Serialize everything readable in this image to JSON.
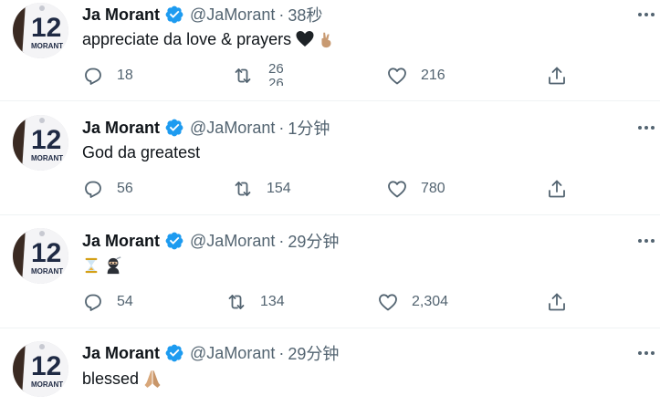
{
  "tweets": [
    {
      "name": "Ja Morant",
      "handle": "@JaMorant",
      "time": "38秒",
      "text": "appreciate da love & prayers",
      "emojis": [
        "black-heart-emoji",
        "crossed-fingers-emoji"
      ],
      "replies": "18",
      "retweets_visible": "26",
      "retweets_next": "26",
      "likes": "216"
    },
    {
      "name": "Ja Morant",
      "handle": "@JaMorant",
      "time": "1分钟",
      "text": "God da greatest",
      "replies": "56",
      "retweets": "154",
      "likes": "780"
    },
    {
      "name": "Ja Morant",
      "handle": "@JaMorant",
      "time": "29分钟",
      "text": "",
      "emojis": [
        "hourglass-emoji",
        "ninja-emoji"
      ],
      "replies": "54",
      "retweets": "134",
      "likes": "2,304"
    },
    {
      "name": "Ja Morant",
      "handle": "@JaMorant",
      "time": "29分钟",
      "text": "blessed",
      "emojis": [
        "praying-hands-emoji"
      ]
    }
  ],
  "separator": "·",
  "avatar_jersey_number": "12",
  "avatar_jersey_name": "MORANT",
  "colors": {
    "verified": "#1d9bf0",
    "text_secondary": "#536471",
    "divider": "#eff3f4"
  }
}
